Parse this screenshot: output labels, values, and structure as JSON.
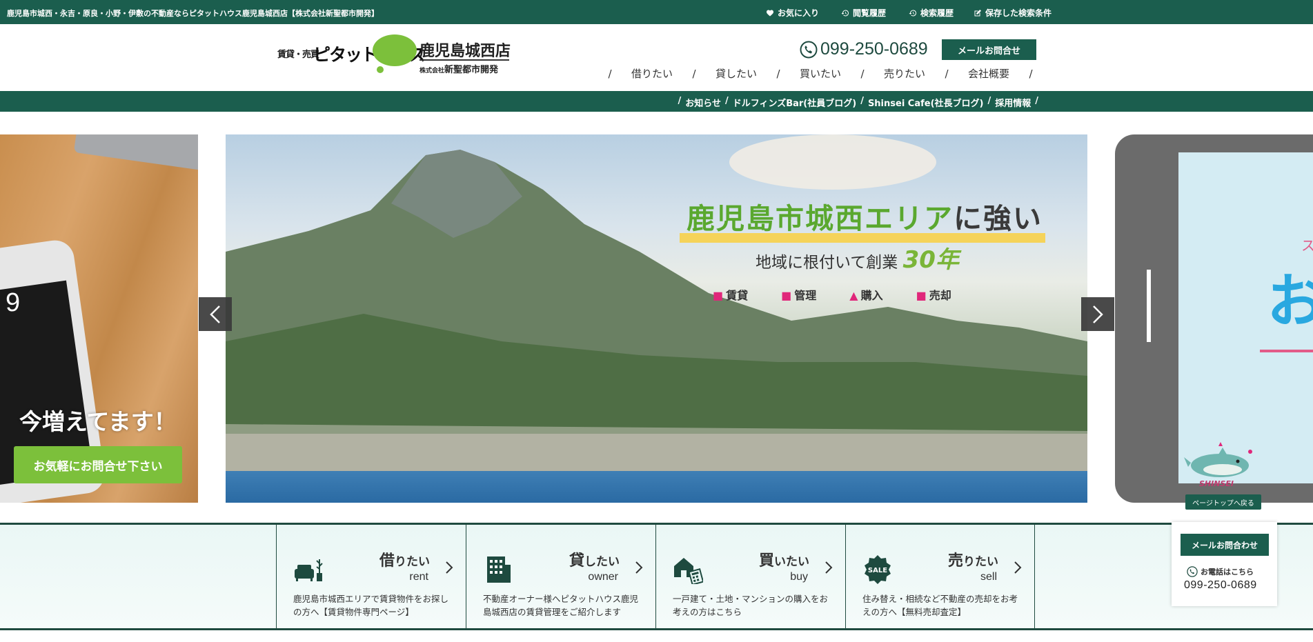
{
  "topbar": {
    "tagline": "鹿児島市城西・永吉・原良・小野・伊敷の不動産ならピタットハウス鹿児島城西店【株式会社新聖都市開発】",
    "links": [
      "お気に入り",
      "閲覧履歴",
      "検索履歴",
      "保存した検索条件"
    ]
  },
  "logo": {
    "small": "賃貸・売買",
    "brand": "ピタットハウス",
    "store": "鹿児島城西店",
    "company_prefix": "株式会社",
    "company": "新聖都市開発"
  },
  "header": {
    "phone": "099-250-0689",
    "mail_button": "メールお問合せ"
  },
  "mainnav": [
    "借りたい",
    "貸したい",
    "買いたい",
    "売りたい",
    "会社概要"
  ],
  "subnav": [
    "お知らせ",
    "ドルフィンズBar(社員ブログ)",
    "Shinsei Cafe(社長ブログ)",
    "採用情報"
  ],
  "slider": {
    "left": {
      "phone_time": "9",
      "heading": "今増えてます！",
      "cta": "お気軽にお問合せ下さい"
    },
    "main": {
      "headline_green": "鹿児島市城西エリア",
      "headline_dark": "に強い",
      "subline": "地域に根付いて創業",
      "years": "30年",
      "services": [
        "賃貸",
        "管理",
        "購入",
        "売却"
      ]
    },
    "right": {
      "big_char": "お",
      "pink_char": "ス"
    }
  },
  "float": {
    "to_top": "ページトップへ戻る",
    "mascot_label": "SHINSEI"
  },
  "categories": [
    {
      "jp": "借",
      "jp_rest": "りたい",
      "en": "rent",
      "desc": "鹿児島市城西エリアで賃貸物件をお探しの方へ【賃貸物件専門ページ】"
    },
    {
      "jp": "貸",
      "jp_rest": "したい",
      "en": "owner",
      "desc": "不動産オーナー様へピタットハウス鹿児島城西店の賃貸管理をご紹介します"
    },
    {
      "jp": "買",
      "jp_rest": "いたい",
      "en": "buy",
      "desc": "一戸建て・土地・マンションの購入をお考えの方はこちら"
    },
    {
      "jp": "売",
      "jp_rest": "りたい",
      "en": "sell",
      "desc": "住み替え・相続など不動産の売却をお考えの方へ【無料売却査定】"
    }
  ],
  "side_contact": {
    "mail": "メールお問合わせ",
    "phone_label": "お電話はこちら",
    "phone": "099-250-0689"
  },
  "colors": {
    "brand_green": "#1b5e4e",
    "accent_green": "#7cc03b",
    "pink": "#e0277a"
  }
}
